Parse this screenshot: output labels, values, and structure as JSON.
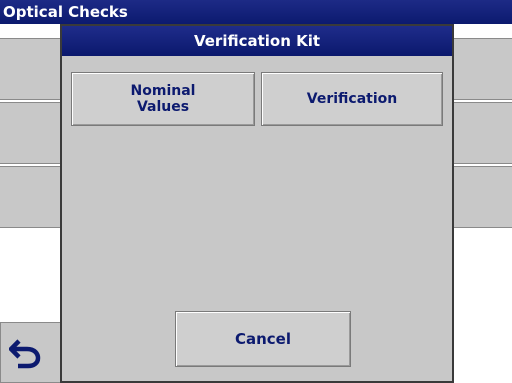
{
  "background": {
    "title": "Optical Checks"
  },
  "dialog": {
    "title": "Verification Kit",
    "buttons": {
      "nominal_values": "Nominal\nValues",
      "verification": "Verification",
      "cancel": "Cancel"
    }
  },
  "icons": {
    "back": "undo-arrow-icon"
  },
  "colors": {
    "title_bar": "#0c1a6f",
    "panel": "#c8c8c8",
    "button_text": "#0c1a6f"
  }
}
